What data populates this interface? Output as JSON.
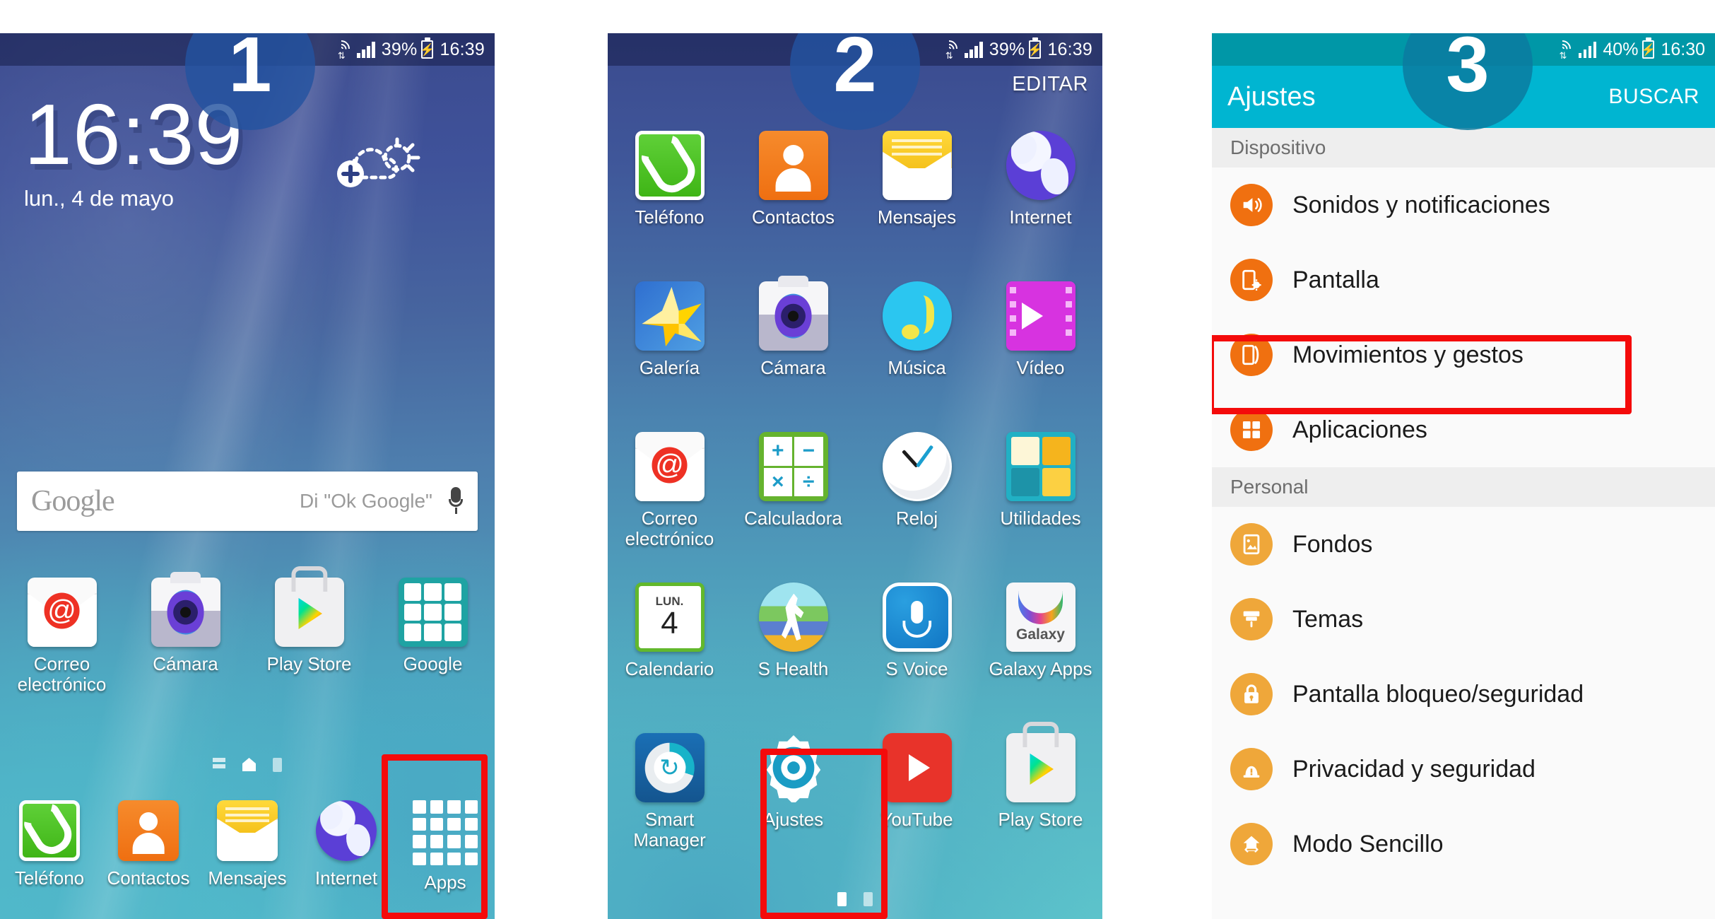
{
  "meta": {
    "device": "Samsung Galaxy",
    "language": "es",
    "accent_red": "#f40b0b",
    "settings_teal": "#00b5d1",
    "settings_teal_dark": "#0097a7"
  },
  "panel1": {
    "step_badge": "1",
    "status_bar": {
      "battery_percent": "39%",
      "clock": "16:39",
      "wifi_icon": "wifi-icon",
      "signal_icon": "signal-icon",
      "battery_icon": "battery-charging-icon"
    },
    "clock_widget": {
      "time": "16:39",
      "date": "lun., 4 de mayo",
      "weather_add_icon": "add-weather-icon"
    },
    "search_widget": {
      "brand": "Google",
      "hint": "Di \"Ok Google\"",
      "mic_icon": "microphone-icon"
    },
    "home_apps": [
      {
        "label": "Correo electrónico",
        "icon": "email-icon"
      },
      {
        "label": "Cámara",
        "icon": "camera-icon"
      },
      {
        "label": "Play Store",
        "icon": "play-store-icon"
      },
      {
        "label": "Google",
        "icon": "google-folder-icon"
      }
    ],
    "page_dots": 3,
    "dock": [
      {
        "label": "Teléfono",
        "icon": "phone-icon"
      },
      {
        "label": "Contactos",
        "icon": "contacts-icon"
      },
      {
        "label": "Mensajes",
        "icon": "messages-icon"
      },
      {
        "label": "Internet",
        "icon": "internet-icon"
      },
      {
        "label": "Apps",
        "icon": "apps-grid-icon",
        "highlighted": true
      }
    ]
  },
  "panel2": {
    "step_badge": "2",
    "status_bar": {
      "battery_percent": "39%",
      "clock": "16:39"
    },
    "edit_label": "EDITAR",
    "apps": [
      {
        "label": "Teléfono",
        "icon": "phone-icon"
      },
      {
        "label": "Contactos",
        "icon": "contacts-icon"
      },
      {
        "label": "Mensajes",
        "icon": "messages-icon"
      },
      {
        "label": "Internet",
        "icon": "internet-icon"
      },
      {
        "label": "Galería",
        "icon": "gallery-icon"
      },
      {
        "label": "Cámara",
        "icon": "camera-icon"
      },
      {
        "label": "Música",
        "icon": "music-icon"
      },
      {
        "label": "Vídeo",
        "icon": "video-icon"
      },
      {
        "label": "Correo electrónico",
        "icon": "email-icon"
      },
      {
        "label": "Calculadora",
        "icon": "calculator-icon"
      },
      {
        "label": "Reloj",
        "icon": "clock-icon"
      },
      {
        "label": "Utilidades",
        "icon": "tools-folder-icon"
      },
      {
        "label": "Calendario",
        "icon": "calendar-icon",
        "day_abbr": "LUN.",
        "day_number": "4"
      },
      {
        "label": "S Health",
        "icon": "s-health-icon"
      },
      {
        "label": "S Voice",
        "icon": "s-voice-icon"
      },
      {
        "label": "Galaxy Apps",
        "icon": "galaxy-apps-icon",
        "icon_text": "Galaxy"
      },
      {
        "label": "Smart Manager",
        "icon": "smart-manager-icon"
      },
      {
        "label": "Ajustes",
        "icon": "settings-gear-icon",
        "highlighted": true
      },
      {
        "label": "YouTube",
        "icon": "youtube-icon"
      },
      {
        "label": "Play Store",
        "icon": "play-store-icon"
      }
    ],
    "page_dots": 2
  },
  "panel3": {
    "step_badge": "3",
    "status_bar": {
      "battery_percent": "40%",
      "clock": "16:30"
    },
    "app_bar": {
      "title": "Ajustes",
      "search_label": "BUSCAR"
    },
    "sections": [
      {
        "header": "Dispositivo",
        "items": [
          {
            "label": "Sonidos y notificaciones",
            "icon": "speaker-icon",
            "color": "#f07010"
          },
          {
            "label": "Pantalla",
            "icon": "display-brightness-icon",
            "color": "#f07010"
          },
          {
            "label": "Movimientos y gestos",
            "icon": "motion-gesture-icon",
            "color": "#f07010",
            "highlighted": true
          },
          {
            "label": "Aplicaciones",
            "icon": "apps-grid-icon",
            "color": "#f07010"
          }
        ]
      },
      {
        "header": "Personal",
        "items": [
          {
            "label": "Fondos",
            "icon": "wallpaper-icon",
            "color": "#efa73a"
          },
          {
            "label": "Temas",
            "icon": "paint-brush-icon",
            "color": "#efa73a"
          },
          {
            "label": "Pantalla bloqueo/seguridad",
            "icon": "lock-icon",
            "color": "#efa73a"
          },
          {
            "label": "Privacidad y seguridad",
            "icon": "privacy-alert-icon",
            "color": "#efa73a"
          },
          {
            "label": "Modo Sencillo",
            "icon": "easy-mode-home-icon",
            "color": "#efa73a"
          }
        ]
      }
    ]
  }
}
